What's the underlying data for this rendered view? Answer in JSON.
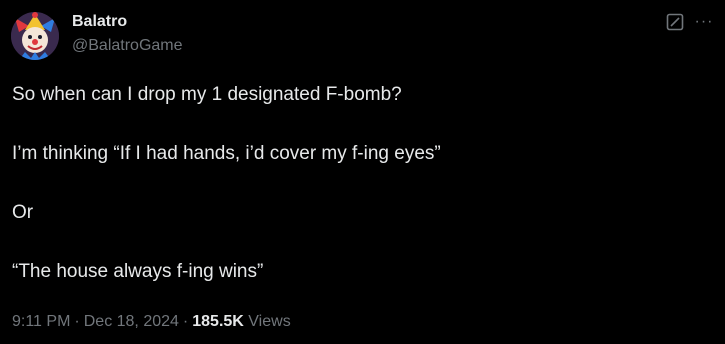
{
  "author": {
    "display_name": "Balatro",
    "handle": "@BalatroGame",
    "avatar_icon": "jester-avatar"
  },
  "actions": {
    "grok_icon": "grok-icon",
    "more_icon": "more-icon",
    "more_label": "···"
  },
  "tweet": {
    "paragraphs": [
      "So when can I drop my 1 designated F-bomb?",
      "I’m thinking “If I had hands, i’d cover my f-ing eyes”",
      "Or",
      "“The house always f-ing wins”"
    ]
  },
  "meta": {
    "time": "9:11 PM",
    "separator": "·",
    "date": "Dec 18, 2024",
    "views_count": "185.5K",
    "views_label": "Views"
  },
  "colors": {
    "background": "#000000",
    "text_primary": "#e7e9ea",
    "text_secondary": "#71767b"
  }
}
